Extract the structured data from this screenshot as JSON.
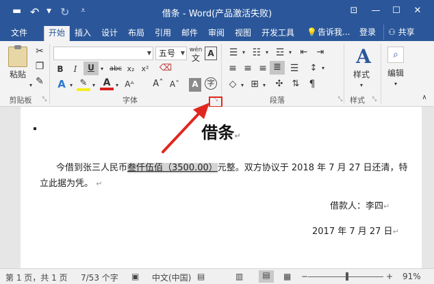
{
  "titlebar": {
    "title": "借条 - Word(产品激活失败)",
    "quick_access": {
      "save": "💾",
      "undo": "↶",
      "redo": "↻",
      "customize": "⩡"
    },
    "minimize": "—",
    "restore": "❐",
    "maximize": "☐",
    "close": "✕"
  },
  "tabs": [
    "文件",
    "开始",
    "插入",
    "设计",
    "布局",
    "引用",
    "邮件",
    "审阅",
    "视图",
    "开发工具"
  ],
  "tell_me": "告诉我...",
  "login": "登录",
  "share": "共享",
  "ribbon": {
    "clipboard": {
      "paste": "粘贴",
      "label": "剪贴板"
    },
    "font": {
      "name": "",
      "size": "五号",
      "phonetic": "wén",
      "label": "字体",
      "bold": "B",
      "italic": "I",
      "underline": "U",
      "strike": "abc",
      "subscript": "x₂",
      "superscript": "x²"
    },
    "paragraph": {
      "label": "段落"
    },
    "styles": {
      "label": "样式",
      "button": "样式"
    },
    "editing": {
      "label": "编辑"
    }
  },
  "document": {
    "title": "借条",
    "para1_pre": "今借到张三人民币",
    "para1_amount": "叁仟伍佰（3500.00）",
    "para1_post": "元整。双方协议于 2018 年 7 月 27 日还清，特",
    "para1_line2": "立此据为凭。",
    "borrower": "借款人：李四",
    "date": "2017 年 7 月 27 日"
  },
  "status": {
    "page": "第 1 页，共 1 页",
    "words": "7/53 个字",
    "language": "中文(中国)",
    "zoom": "91%"
  },
  "colors": {
    "brand": "#2b579a",
    "highlight": "#e0271f"
  }
}
